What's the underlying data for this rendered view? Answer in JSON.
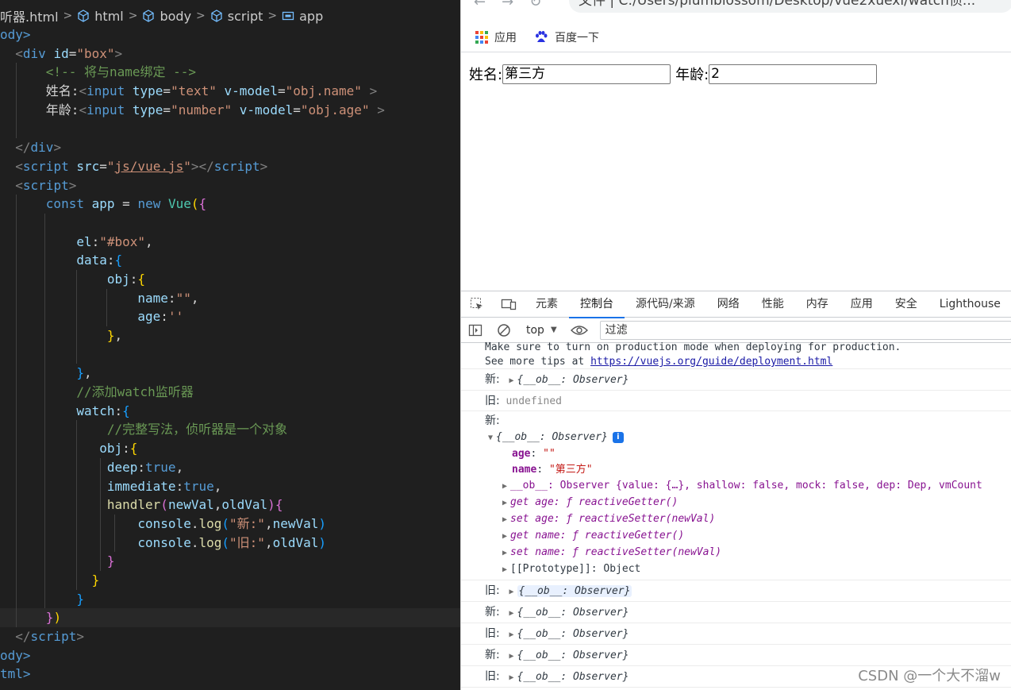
{
  "editor": {
    "breadcrumb": [
      "听器.html",
      "html",
      "body",
      "script",
      "app"
    ],
    "code": {
      "body_open": "ody>",
      "div_id": "box",
      "comment_bind": "<!-- 将与name绑定 -->",
      "label_name": "姓名:",
      "label_age": "年龄:",
      "input_type_text": "text",
      "input_type_number": "number",
      "vmodel_name": "obj.name",
      "vmodel_age": "obj.age",
      "script_src": "js/vue.js",
      "const_app": "app",
      "el_value": "#box",
      "name_value": "\"\"",
      "age_value": "''",
      "comment_watch": "//添加watch监听器",
      "comment_full": "//完整写法，侦听器是一个对象",
      "deep_value": "true",
      "immediate_value": "true",
      "log_new": "新:",
      "log_old": "旧:",
      "body_close": "ody>",
      "html_close": "tml>"
    }
  },
  "browser": {
    "address": "文件 | C:/Users/plumblossom/Desktop/vue2xuexi/watch侦...",
    "bookmarks": [
      "应用",
      "百度一下"
    ],
    "page": {
      "name_label": "姓名:",
      "name_value": "第三方",
      "age_label": "年龄:",
      "age_value": "2"
    }
  },
  "devtools": {
    "tabs": [
      "元素",
      "控制台",
      "源代码/来源",
      "网络",
      "性能",
      "内存",
      "应用",
      "安全",
      "Lighthouse"
    ],
    "active_tab": "控制台",
    "context": "top",
    "filter_placeholder": "过滤",
    "production_line1": "Make sure to turn on production mode when deploying for production.",
    "production_line2_prefix": "See more tips at ",
    "production_link": "https://vuejs.org/guide/deployment.html",
    "observer_summary": "{__ob__: Observer}",
    "messages": [
      {
        "prefix": "新:",
        "value": "{__ob__: Observer}"
      },
      {
        "prefix": "旧:",
        "value": "undefined"
      }
    ],
    "expanded": {
      "prefix": "新:",
      "summary": "{__ob__: Observer}",
      "age_key": "age",
      "age_val": "\"\"",
      "name_key": "name",
      "name_val": "\"第三方\"",
      "ob_line": "__ob__: Observer {value: {…}, shallow: false, mock: false, dep: Dep, vmCount",
      "get_age": "get age: ƒ reactiveGetter()",
      "set_age": "set age: ƒ reactiveSetter(newVal)",
      "get_name": "get name: ƒ reactiveGetter()",
      "set_name": "set name: ƒ reactiveSetter(newVal)",
      "proto": "[[Prototype]]: Object"
    },
    "tail_messages": [
      {
        "prefix": "旧:",
        "value": "{__ob__: Observer}",
        "highlight": true
      },
      {
        "prefix": "新:",
        "value": "{__ob__: Observer}"
      },
      {
        "prefix": "旧:",
        "value": "{__ob__: Observer}"
      },
      {
        "prefix": "新:",
        "value": "{__ob__: Observer}"
      },
      {
        "prefix": "旧:",
        "value": "{__ob__: Observer}"
      }
    ]
  },
  "watermark": "CSDN @一个大不溜w",
  "colors": {
    "editor_bg": "#1f1f1f",
    "tab_accent": "#1a73e8"
  }
}
